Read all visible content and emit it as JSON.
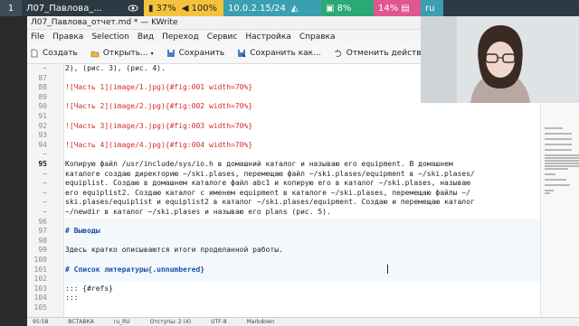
{
  "panel": {
    "workspace": "1",
    "window_task": "Л07_Павлова_...",
    "battery": "37%",
    "volume": "100%",
    "ip": "10.0.2.15/24",
    "cpu": "8%",
    "mem": "14%",
    "lang": "ru"
  },
  "window": {
    "title": "Л07_Павлова_отчет.md * — KWrite"
  },
  "menu": [
    "File",
    "Правка",
    "Selection",
    "Вид",
    "Переход",
    "Сервис",
    "Настройка",
    "Справка"
  ],
  "toolbar": {
    "new": "Создать",
    "open": "Открыть...",
    "save": "Сохранить",
    "save_as": "Сохранить как...",
    "undo": "Отменить действие"
  },
  "editor": {
    "lines": [
      {
        "num": "~",
        "text": "2), (рис. 3), (рис. 4)."
      },
      {
        "num": "87",
        "text": ""
      },
      {
        "num": "88",
        "text": "![Часть 1](image/1.jpg){#fig:001 width=70%}",
        "kind": "img"
      },
      {
        "num": "89",
        "text": ""
      },
      {
        "num": "90",
        "text": "![Часть 2](image/2.jpg){#fig:002 width=70%}",
        "kind": "img"
      },
      {
        "num": "91",
        "text": ""
      },
      {
        "num": "92",
        "text": "![Часть 3](image/3.jpg){#fig:003 width=70%}",
        "kind": "img"
      },
      {
        "num": "93",
        "text": ""
      },
      {
        "num": "94",
        "text": "![Часть 4](image/4.jpg){#fig:004 width=70%}",
        "kind": "img"
      },
      {
        "num": "~",
        "text": ""
      },
      {
        "num": "95",
        "text": "Копирую файл /usr/include/sys/io.h в домашний каталог и называю его equipment. В домашнем",
        "current": true
      },
      {
        "num": "~",
        "text": "каталоге создаю директорию ~/ski.plases, перемещаю файл ~/ski.plases/equipment в ~/ski.plases/"
      },
      {
        "num": "~",
        "text": "equiplist. Создаю в домашнем каталоге файл abc1 и копирую его в каталог ~/ski.plases, называю"
      },
      {
        "num": "~",
        "text": "его equiplist2. Создаю каталог с именем equipment в каталоге ~/ski.plases, перемещаю файлы ~/"
      },
      {
        "num": "~",
        "text": "ski.plases/equiplist и equiplist2 в каталог ~/ski.plases/equipment. Создаю и перемещаю каталог"
      },
      {
        "num": "~",
        "text": "~/newdir в каталог ~/ski.plases и называю его plans (рис. 5)."
      },
      {
        "num": "96",
        "text": ""
      },
      {
        "num": "97",
        "text": "# Выводы",
        "kind": "hd"
      },
      {
        "num": "98",
        "text": ""
      },
      {
        "num": "99",
        "text": "Здесь кратко описываются итоги проделанной работы."
      },
      {
        "num": "100",
        "text": ""
      },
      {
        "num": "101",
        "text": "# Список литературы{.unnumbered}",
        "kind": "hd"
      },
      {
        "num": "102",
        "text": ""
      },
      {
        "num": "103",
        "text": "::: {#refs}"
      },
      {
        "num": "104",
        "text": ":::"
      },
      {
        "num": "105",
        "text": ""
      }
    ]
  },
  "statusbar": {
    "position": "95:58",
    "mode": "ВСТАВКА",
    "lang": "ru_RU",
    "indent": "Отступы: 2 (4)",
    "encoding": "UTF-8",
    "syntax": "Markdown"
  },
  "colors": {
    "panel_bg": "#2d3a44",
    "battery_bg": "#f5c33b",
    "ip_bg": "#3a9fb0",
    "cpu_bg": "#2aa876",
    "mem_bg": "#e0568e",
    "img_link": "#d42a2a",
    "heading": "#1e4fa8"
  }
}
